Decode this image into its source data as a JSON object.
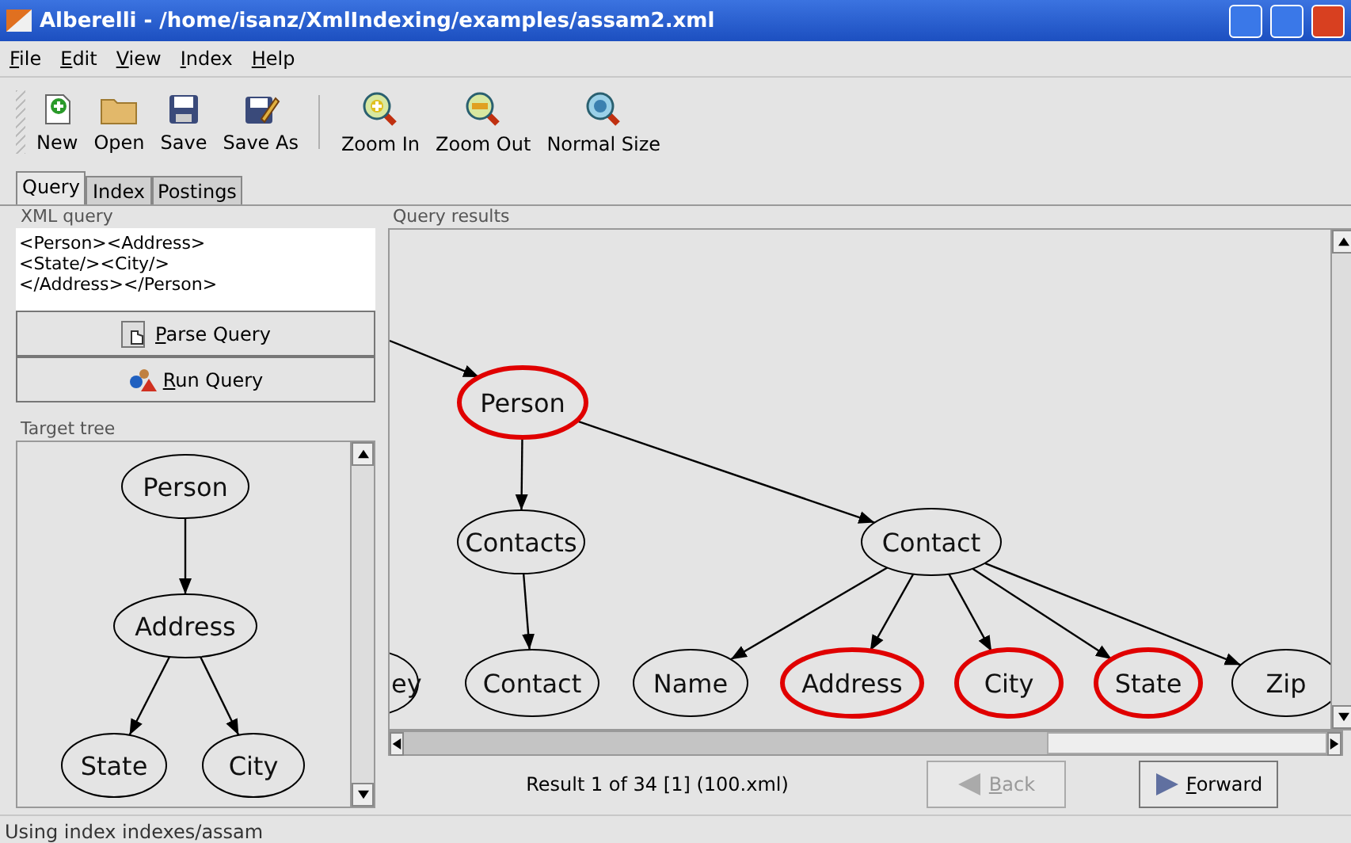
{
  "window": {
    "title": "Alberelli - /home/isanz/XmlIndexing/examples/assam2.xml"
  },
  "menu": [
    {
      "label": "File"
    },
    {
      "label": "Edit"
    },
    {
      "label": "View"
    },
    {
      "label": "Index"
    },
    {
      "label": "Help"
    }
  ],
  "toolbar": {
    "groups": [
      [
        {
          "label": "New"
        },
        {
          "label": "Open"
        },
        {
          "label": "Save"
        },
        {
          "label": "Save As"
        }
      ],
      [
        {
          "label": "Zoom In"
        },
        {
          "label": "Zoom Out"
        },
        {
          "label": "Normal Size"
        }
      ]
    ]
  },
  "tabs": [
    {
      "label": "Query",
      "selected": true
    },
    {
      "label": "Index",
      "selected": false
    },
    {
      "label": "Postings",
      "selected": false
    }
  ],
  "query": {
    "legend": "XML query",
    "value": "<Person><Address>\n<State/><City/>\n</Address></Person>",
    "buttons": [
      {
        "label": "Parse Query"
      },
      {
        "label": "Run Query"
      }
    ]
  },
  "target_tree": {
    "legend": "Target tree",
    "nodes": [
      {
        "label": "Person",
        "children": [
          {
            "label": "Address",
            "children": [
              {
                "label": "State"
              },
              {
                "label": "City"
              }
            ]
          }
        ]
      }
    ]
  },
  "results": {
    "legend": "Query results",
    "nodes": [
      {
        "label": "ey",
        "highlighted": false
      },
      {
        "label": "Person",
        "highlighted": true,
        "children": [
          {
            "label": "Contacts",
            "highlighted": false,
            "children": [
              {
                "label": "Contact",
                "highlighted": false
              }
            ]
          },
          {
            "label": "Contact",
            "highlighted": false,
            "children": [
              {
                "label": "Name",
                "highlighted": false
              },
              {
                "label": "Address",
                "highlighted": true
              },
              {
                "label": "City",
                "highlighted": true
              },
              {
                "label": "State",
                "highlighted": true
              },
              {
                "label": "Zip",
                "highlighted": false
              }
            ]
          }
        ]
      }
    ],
    "summary": "Result 1 of 34 [1] (100.xml)",
    "back": {
      "label": "Back",
      "disabled": true
    },
    "forward": {
      "label": "Forward",
      "disabled": false
    }
  },
  "status_bar": "Using index indexes/assam"
}
